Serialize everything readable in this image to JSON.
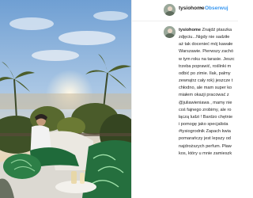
{
  "post": {
    "username": "tysiohome",
    "separator": "•",
    "follow_label": "Obserwuj",
    "caption": {
      "username": "tysiohome",
      "first_line_text": "Znajdź ptaszka",
      "lines": [
        "zdjęciu...Nigdy nie sadziłe",
        "aż tak docenieć mój kawałe",
        "Warszawie. Pierwszy zachó",
        "w tym roku na tarasie. Jeszc",
        "trzeba poprawić, roślinki m",
        "odbić po zimie. Ilak, palmy",
        "zewnątrz cały rok) jeszcze t",
        "chłodno, ale mam super ko",
        "miałem okazji pracować z",
        "@juliawieniawa , mamy nie",
        "coś fajnego zrobimy, ale ro",
        "łączą ludzi ! Bardzo chętnie",
        "i pomogę jako specjalista",
        "#tysiogrodnik Zapach kwia",
        "pomarańczy jest lepszy od",
        "najdroższych perfum. Pław",
        "kos, który u mnie zamieszk"
      ]
    }
  }
}
